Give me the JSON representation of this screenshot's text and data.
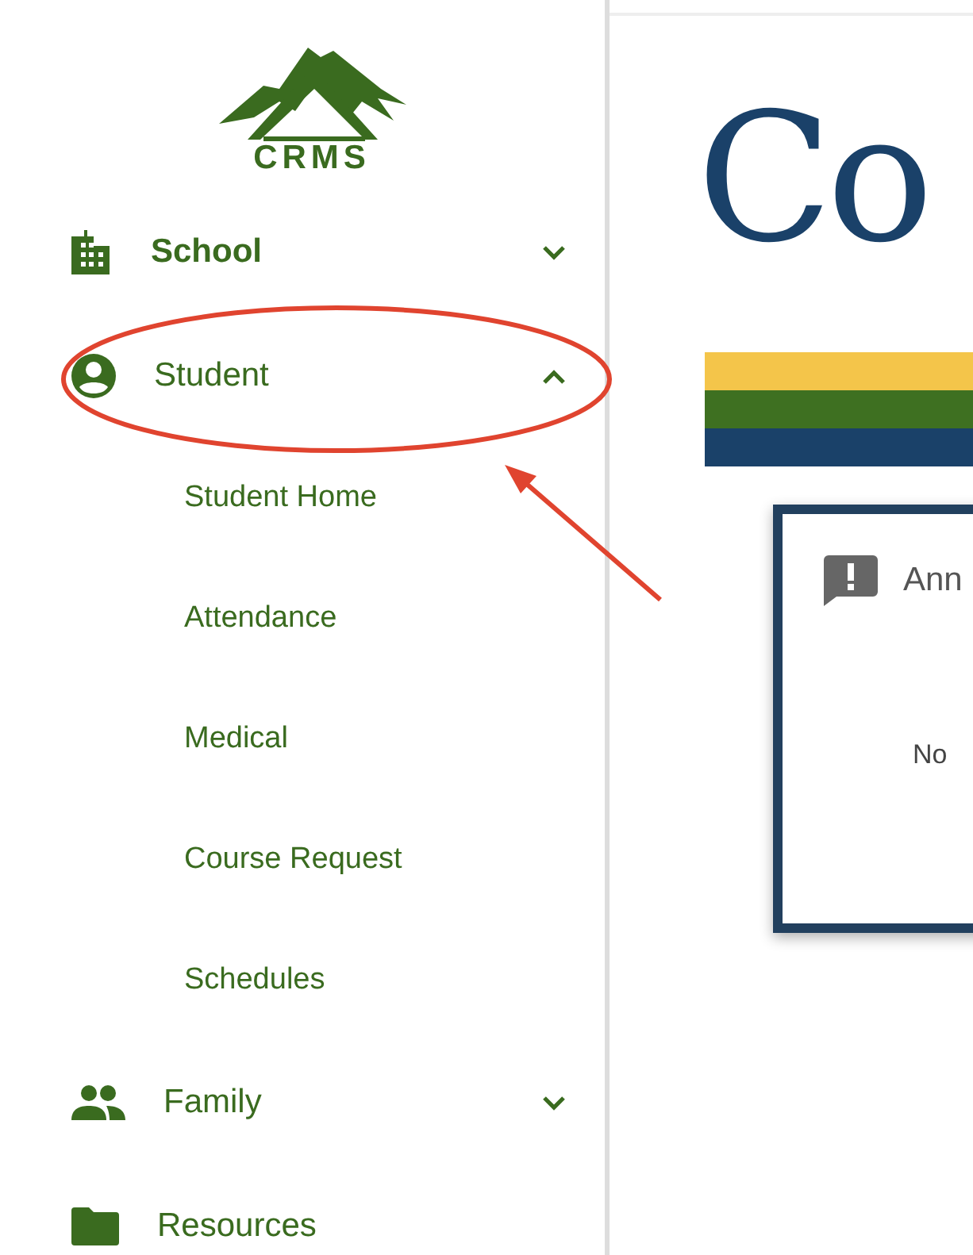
{
  "logo": {
    "text": "CRMS"
  },
  "nav": [
    {
      "label": "School",
      "kind": "group",
      "selected": true,
      "expanded": false
    },
    {
      "label": "Student",
      "kind": "group",
      "selected": false,
      "expanded": true,
      "children": [
        {
          "label": "Student Home",
          "selected": false
        },
        {
          "label": "Attendance",
          "selected": false
        },
        {
          "label": "Medical",
          "selected": false
        },
        {
          "label": "Course Request",
          "selected": false
        },
        {
          "label": "Schedules",
          "selected": false
        }
      ]
    },
    {
      "label": "Family",
      "kind": "group",
      "selected": false,
      "expanded": false
    },
    {
      "label": "Resources",
      "kind": "link",
      "selected": false
    }
  ],
  "main": {
    "title": "Co",
    "card": {
      "title": "Ann",
      "body": "No"
    }
  }
}
